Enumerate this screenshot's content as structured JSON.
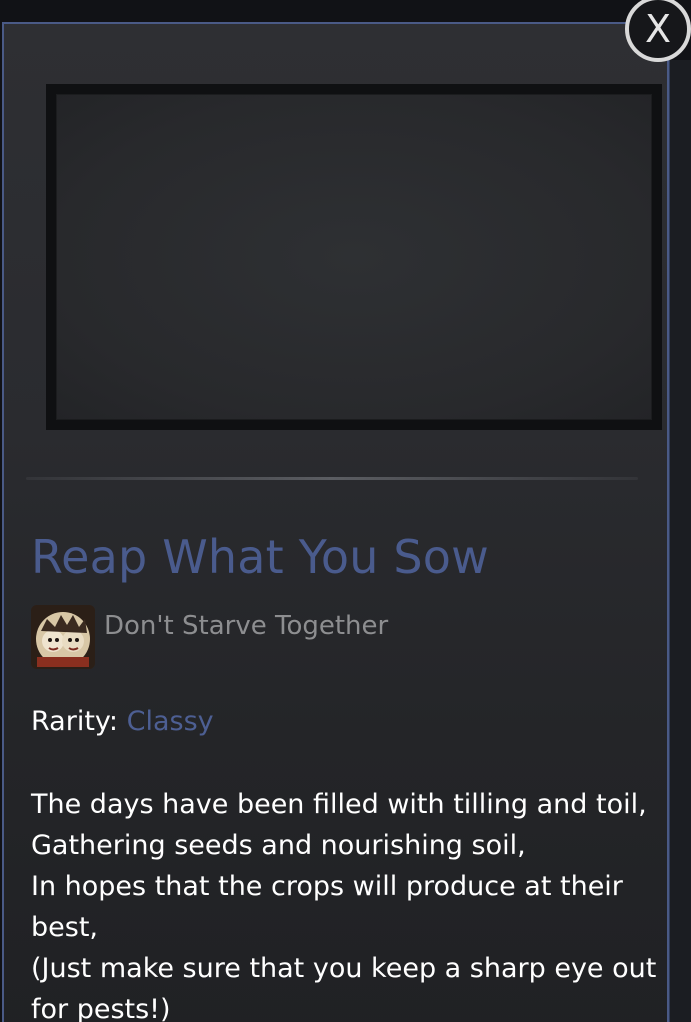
{
  "item": {
    "title": "Reap What You Sow",
    "game_name": "Don't Starve Together",
    "rarity_label": "Rarity:",
    "rarity_value": "Classy",
    "description_lines": [
      "The days have been filled with tilling and toil,",
      "Gathering seeds and nourishing soil,",
      "In hopes that the crops will produce at their",
      "best,",
      "(Just make sure that you keep a sharp eye out",
      "for pests!)"
    ]
  },
  "close_button": {
    "label": "X"
  },
  "colors": {
    "title": "#4a5b8d",
    "rarity_value": "#4d5f93",
    "card_border": "#4a5a86",
    "body_text": "#ffffff",
    "muted_text": "#8d8e90"
  },
  "icons": {
    "game": "game-icon",
    "close": "close-icon"
  }
}
